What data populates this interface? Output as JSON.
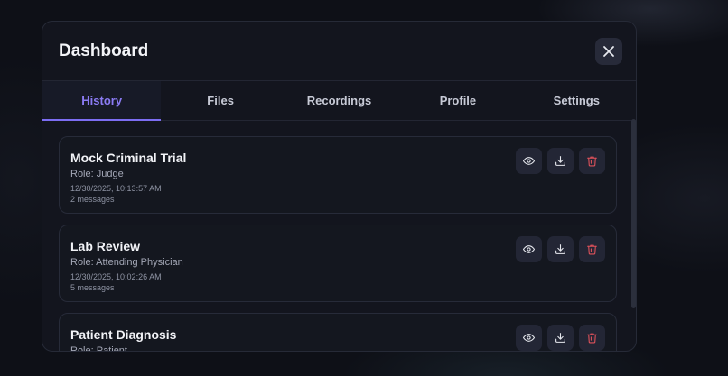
{
  "dashboard": {
    "title": "Dashboard",
    "tabs": [
      {
        "label": "History",
        "active": true
      },
      {
        "label": "Files",
        "active": false
      },
      {
        "label": "Recordings",
        "active": false
      },
      {
        "label": "Profile",
        "active": false
      },
      {
        "label": "Settings",
        "active": false
      }
    ],
    "history": [
      {
        "title": "Mock Criminal Trial",
        "role": "Role: Judge",
        "timestamp": "12/30/2025, 10:13:57 AM",
        "messages": "2 messages"
      },
      {
        "title": "Lab Review",
        "role": "Role: Attending Physician",
        "timestamp": "12/30/2025, 10:02:26 AM",
        "messages": "5 messages"
      },
      {
        "title": "Patient Diagnosis",
        "role": "Role: Patient",
        "timestamp": "",
        "messages": ""
      }
    ],
    "icons": {
      "close": "close-icon",
      "view": "eye-icon",
      "download": "download-icon",
      "delete": "trash-icon"
    },
    "colors": {
      "accent": "#7c6df2",
      "danger": "#e0525b",
      "surface": "#13151e"
    }
  }
}
